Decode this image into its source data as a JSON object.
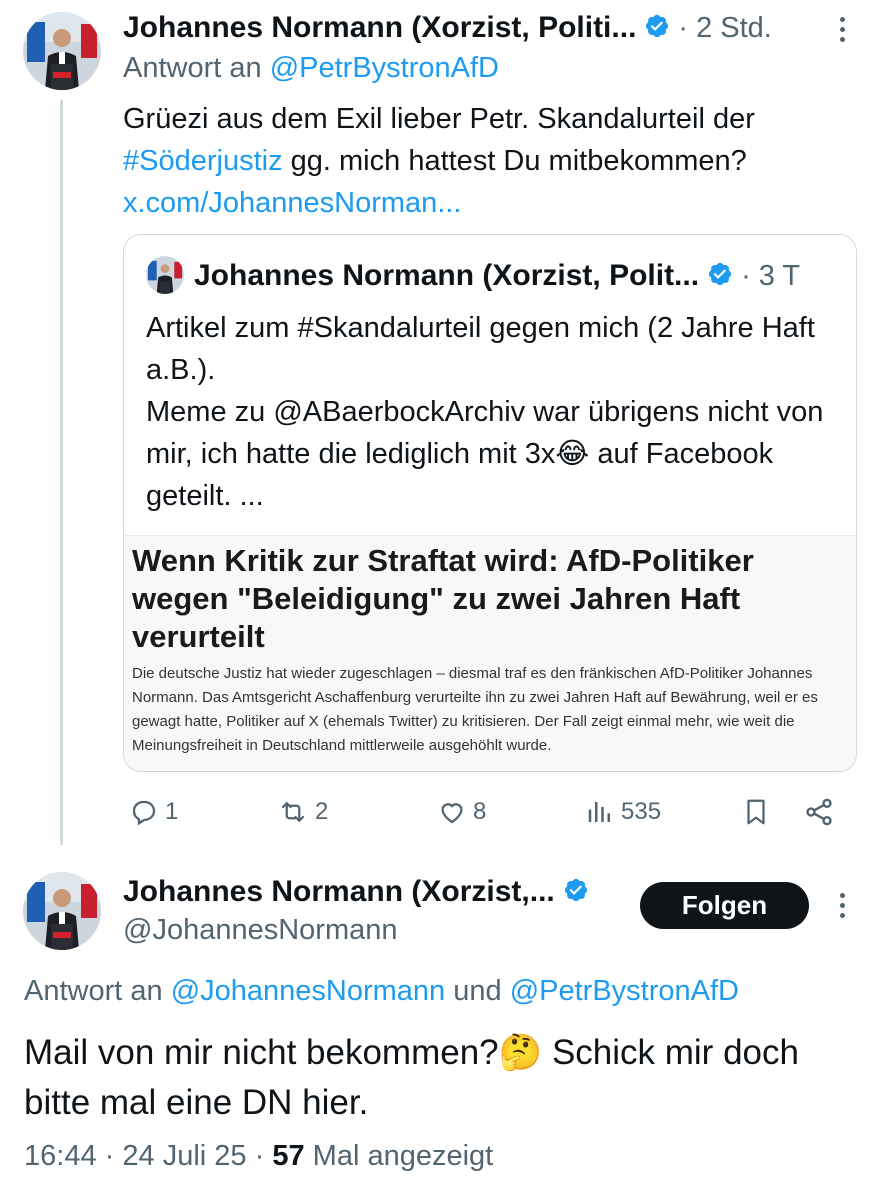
{
  "tweet1": {
    "name": "Johannes Normann (Xorzist, Politi...",
    "time": "2 Std.",
    "reply_prefix": "Antwort an",
    "reply_handle": "@PetrBystronAfD",
    "body_part1": "Grüezi aus dem Exil lieber Petr. Skandalurteil der",
    "hashtag": "#Söderjustiz",
    "body_part2": "gg. mich hattest Du mitbekommen?",
    "link": "x.com/JohannesNorman...",
    "quote": {
      "name": "Johannes Normann (Xorzist, Polit...",
      "time": "3 T",
      "line1": "Artikel zum #Skandalurteil gegen mich (2 Jahre Haft a.B.).",
      "line2_prefix": "Meme zu @ABaerbockArchiv war übrigens nicht von mir, ich hatte die lediglich mit 3x",
      "emoji": "😂",
      "line2_suffix": " auf Facebook geteilt. ...",
      "article_title": "Wenn Kritik zur Straftat wird: AfD-Politiker wegen \"Beleidigung\" zu zwei Jahren Haft verurteilt",
      "article_desc": "Die deutsche Justiz hat wieder zugeschlagen – diesmal traf es den fränkischen AfD-Politiker Johannes Normann. Das Amtsgericht Aschaffenburg verurteilte ihn zu zwei Jahren Haft auf Bewährung, weil er es gewagt hatte, Politiker auf X (ehemals Twitter) zu kritisieren. Der Fall zeigt einmal mehr, wie weit die Meinungsfreiheit in Deutschland mittlerweile ausgehöhlt wurde."
    },
    "actions": {
      "replies": "1",
      "reposts": "2",
      "likes": "8",
      "views": "535"
    }
  },
  "tweet2": {
    "name": "Johannes Normann (Xorzist,...",
    "handle": "@JohannesNormann",
    "follow_label": "Folgen",
    "reply_prefix": "Antwort an",
    "reply_handle1": "@JohannesNormann",
    "reply_and": "und",
    "reply_handle2": "@PetrBystronAfD",
    "body_part1": "Mail von mir nicht bekommen?",
    "emoji": "🤔",
    "body_part2": " Schick mir doch bitte mal eine DN hier.",
    "time": "16:44",
    "date": "24 Juli 25",
    "views_count": "57",
    "views_label": "Mal angezeigt"
  },
  "colors": {
    "link": "#1d9bf0",
    "muted": "#536471",
    "text": "#0f1419",
    "verified": "#1d9bf0"
  },
  "icons": [
    "reply-icon",
    "repost-icon",
    "like-icon",
    "views-icon",
    "bookmark-icon",
    "share-icon",
    "verified-icon",
    "more-icon"
  ]
}
